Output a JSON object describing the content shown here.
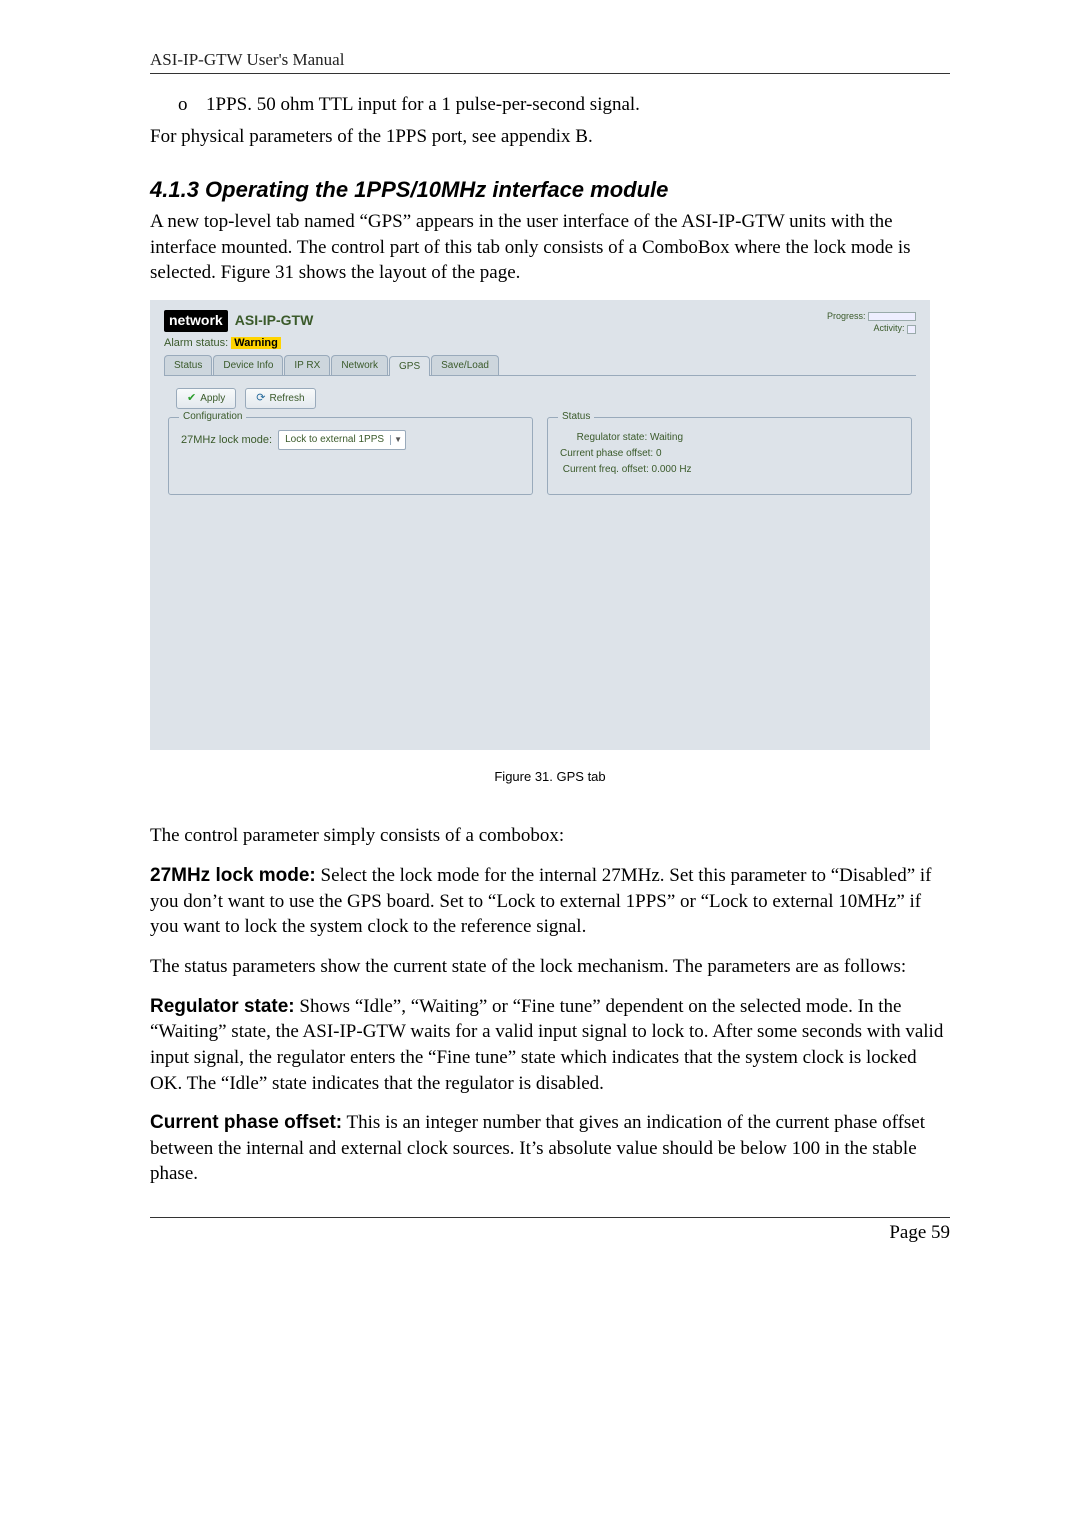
{
  "header": "ASI-IP-GTW User's Manual",
  "bullet": {
    "marker": "o",
    "text": "1PPS. 50 ohm TTL input for a 1 pulse-per-second signal."
  },
  "line_after_bullet": "For physical parameters of the 1PPS port, see appendix B.",
  "section_heading": "4.1.3 Operating the 1PPS/10MHz interface module",
  "section_intro": "A new top-level tab named “GPS” appears in the user interface of the ASI-IP-GTW units with the interface mounted. The control part of this tab only consists of a ComboBox where the lock mode is selected. Figure 31 shows the layout of the page.",
  "screenshot": {
    "logo": "network",
    "title": "ASI-IP-GTW",
    "progress_label": "Progress:",
    "activity_label": "Activity:",
    "alarm_label": "Alarm status: ",
    "alarm_value": "Warning",
    "tabs": [
      "Status",
      "Device Info",
      "IP RX",
      "Network",
      "GPS",
      "Save/Load"
    ],
    "apply_label": "Apply",
    "refresh_label": "Refresh",
    "config_legend": "Configuration",
    "config_label": "27MHz lock mode:",
    "config_value": "Lock to external 1PPS",
    "status_legend": "Status",
    "status_lines": [
      "      Regulator state: Waiting",
      "Current phase offset: 0",
      " Current freq. offset: 0.000 Hz"
    ]
  },
  "figure_caption": "Figure 31. GPS tab",
  "para_control_intro": "The control parameter simply consists of a combobox:",
  "para_27mhz_label": "27MHz lock mode:",
  "para_27mhz_text": " Select the lock mode for the internal 27MHz. Set this parameter to “Disabled” if you don’t want to use the GPS board. Set to “Lock to external 1PPS” or “Lock to external 10MHz” if you want to lock the system clock to the reference signal.",
  "para_status_intro": "The status parameters show the current state of the lock mechanism. The parameters are as follows:",
  "para_reg_label": "Regulator state:",
  "para_reg_text": " Shows “Idle”, “Waiting” or “Fine tune” dependent on the selected mode. In the “Waiting” state, the ASI-IP-GTW waits for a valid input signal to lock to. After some seconds with valid input signal, the regulator enters the “Fine tune” state which indicates that the system clock is locked OK. The “Idle” state indicates that the regulator is disabled.",
  "para_phase_label": "Current phase offset:",
  "para_phase_text": " This is an integer number that gives an indication of the current phase offset between the internal and external clock sources. It’s absolute value should be below 100 in the stable phase.",
  "footer": "Page 59"
}
